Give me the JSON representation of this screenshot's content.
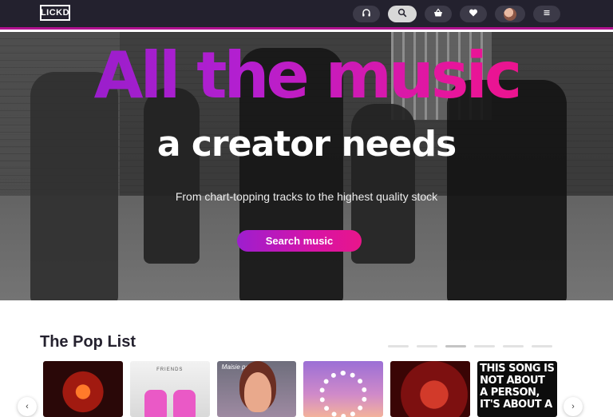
{
  "header": {
    "logo_text": "LICKD",
    "nav": [
      {
        "name": "headphones-icon",
        "glyph": "∩"
      },
      {
        "name": "search-icon",
        "glyph": "⌕"
      },
      {
        "name": "basket-icon",
        "glyph": "◡"
      },
      {
        "name": "heart-icon",
        "glyph": "♥"
      },
      {
        "name": "avatar",
        "glyph": ""
      },
      {
        "name": "menu-icon",
        "glyph": "≡"
      }
    ]
  },
  "hero": {
    "headline_primary": "All the music",
    "headline_secondary": "a creator needs",
    "subtitle": "From chart-topping tracks to the highest quality stock",
    "cta_label": "Search music"
  },
  "pop_list": {
    "title": "The Pop List",
    "pagination_count": 6,
    "active_page": 3,
    "cards": [
      {
        "name": "album-card-1",
        "text": ""
      },
      {
        "name": "album-card-2",
        "text": "FRIENDS"
      },
      {
        "name": "album-card-3",
        "text": "Maisie peters"
      },
      {
        "name": "album-card-4",
        "text": ""
      },
      {
        "name": "album-card-5",
        "text": ""
      },
      {
        "name": "album-card-6",
        "text": "THIS SONG IS NOT ABOUT A PERSON, IT'S ABOUT A"
      }
    ],
    "prev_glyph": "‹",
    "next_glyph": "›"
  },
  "colors": {
    "header_bg": "#23212e",
    "accent_magenta": "#b1108f",
    "gradient_start": "#8a1ec9",
    "gradient_end": "#f0127c"
  }
}
